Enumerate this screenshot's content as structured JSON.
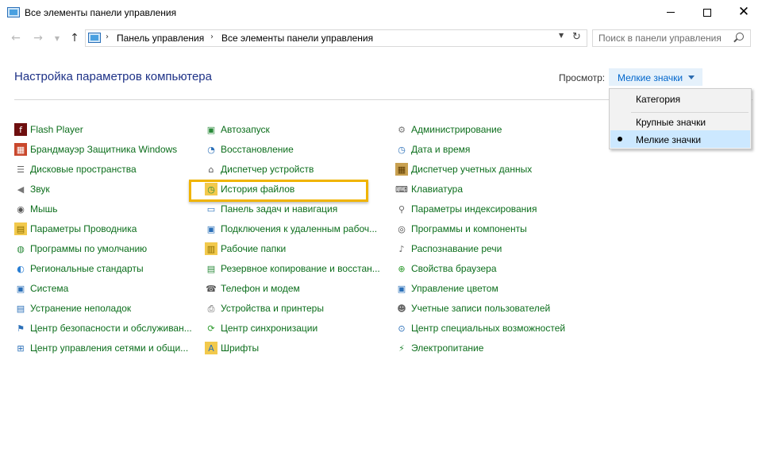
{
  "window": {
    "title": "Все элементы панели управления"
  },
  "address": {
    "crumbs": [
      "Панель управления",
      "Все элементы панели управления"
    ]
  },
  "search": {
    "placeholder": "Поиск в панели управления"
  },
  "header": {
    "title": "Настройка параметров компьютера",
    "view_label": "Просмотр:",
    "view_value": "Мелкие значки"
  },
  "view_menu": {
    "options": [
      "Категория",
      "Крупные значки",
      "Мелкие значки"
    ],
    "selected": "Мелкие значки"
  },
  "items": {
    "col1": [
      {
        "label": "Flash Player",
        "icon": "flash-player-icon"
      },
      {
        "label": "Брандмауэр Защитника Windows",
        "icon": "firewall-icon"
      },
      {
        "label": "Дисковые пространства",
        "icon": "storage-spaces-icon"
      },
      {
        "label": "Звук",
        "icon": "sound-icon"
      },
      {
        "label": "Мышь",
        "icon": "mouse-icon"
      },
      {
        "label": "Параметры Проводника",
        "icon": "folder-options-icon"
      },
      {
        "label": "Программы по умолчанию",
        "icon": "default-programs-icon"
      },
      {
        "label": "Региональные стандарты",
        "icon": "region-icon"
      },
      {
        "label": "Система",
        "icon": "system-icon"
      },
      {
        "label": "Устранение неполадок",
        "icon": "troubleshooting-icon"
      },
      {
        "label": "Центр безопасности и обслуживан...",
        "icon": "security-flag-icon"
      },
      {
        "label": "Центр управления сетями и общи...",
        "icon": "network-center-icon"
      }
    ],
    "col2": [
      {
        "label": "Автозапуск",
        "icon": "autoplay-icon"
      },
      {
        "label": "Восстановление",
        "icon": "recovery-icon"
      },
      {
        "label": "Диспетчер устройств",
        "icon": "device-manager-icon"
      },
      {
        "label": "История файлов",
        "icon": "file-history-icon"
      },
      {
        "label": "Панель задач и навигация",
        "icon": "taskbar-icon"
      },
      {
        "label": "Подключения к удаленным рабоч...",
        "icon": "remote-desktop-icon"
      },
      {
        "label": "Рабочие папки",
        "icon": "work-folders-icon"
      },
      {
        "label": "Резервное копирование и восстан...",
        "icon": "backup-icon"
      },
      {
        "label": "Телефон и модем",
        "icon": "phone-modem-icon"
      },
      {
        "label": "Устройства и принтеры",
        "icon": "devices-printers-icon"
      },
      {
        "label": "Центр синхронизации",
        "icon": "sync-center-icon"
      },
      {
        "label": "Шрифты",
        "icon": "fonts-icon"
      }
    ],
    "col3": [
      {
        "label": "Администрирование",
        "icon": "admin-tools-icon"
      },
      {
        "label": "Дата и время",
        "icon": "date-time-icon"
      },
      {
        "label": "Диспетчер учетных данных",
        "icon": "credential-manager-icon"
      },
      {
        "label": "Клавиатура",
        "icon": "keyboard-icon"
      },
      {
        "label": "Параметры индексирования",
        "icon": "indexing-icon"
      },
      {
        "label": "Программы и компоненты",
        "icon": "programs-features-icon"
      },
      {
        "label": "Распознавание речи",
        "icon": "speech-icon"
      },
      {
        "label": "Свойства браузера",
        "icon": "internet-options-icon"
      },
      {
        "label": "Управление цветом",
        "icon": "color-management-icon"
      },
      {
        "label": "Учетные записи пользователей",
        "icon": "user-accounts-icon"
      },
      {
        "label": "Центр специальных возможностей",
        "icon": "ease-of-access-icon"
      },
      {
        "label": "Электропитание",
        "icon": "power-options-icon"
      }
    ]
  },
  "highlighted_item": "История файлов",
  "colors": {
    "title_blue": "#1e3287",
    "link_green": "#0c6e1c",
    "highlight": "#f0b400",
    "menu_selected": "#cce8ff"
  }
}
